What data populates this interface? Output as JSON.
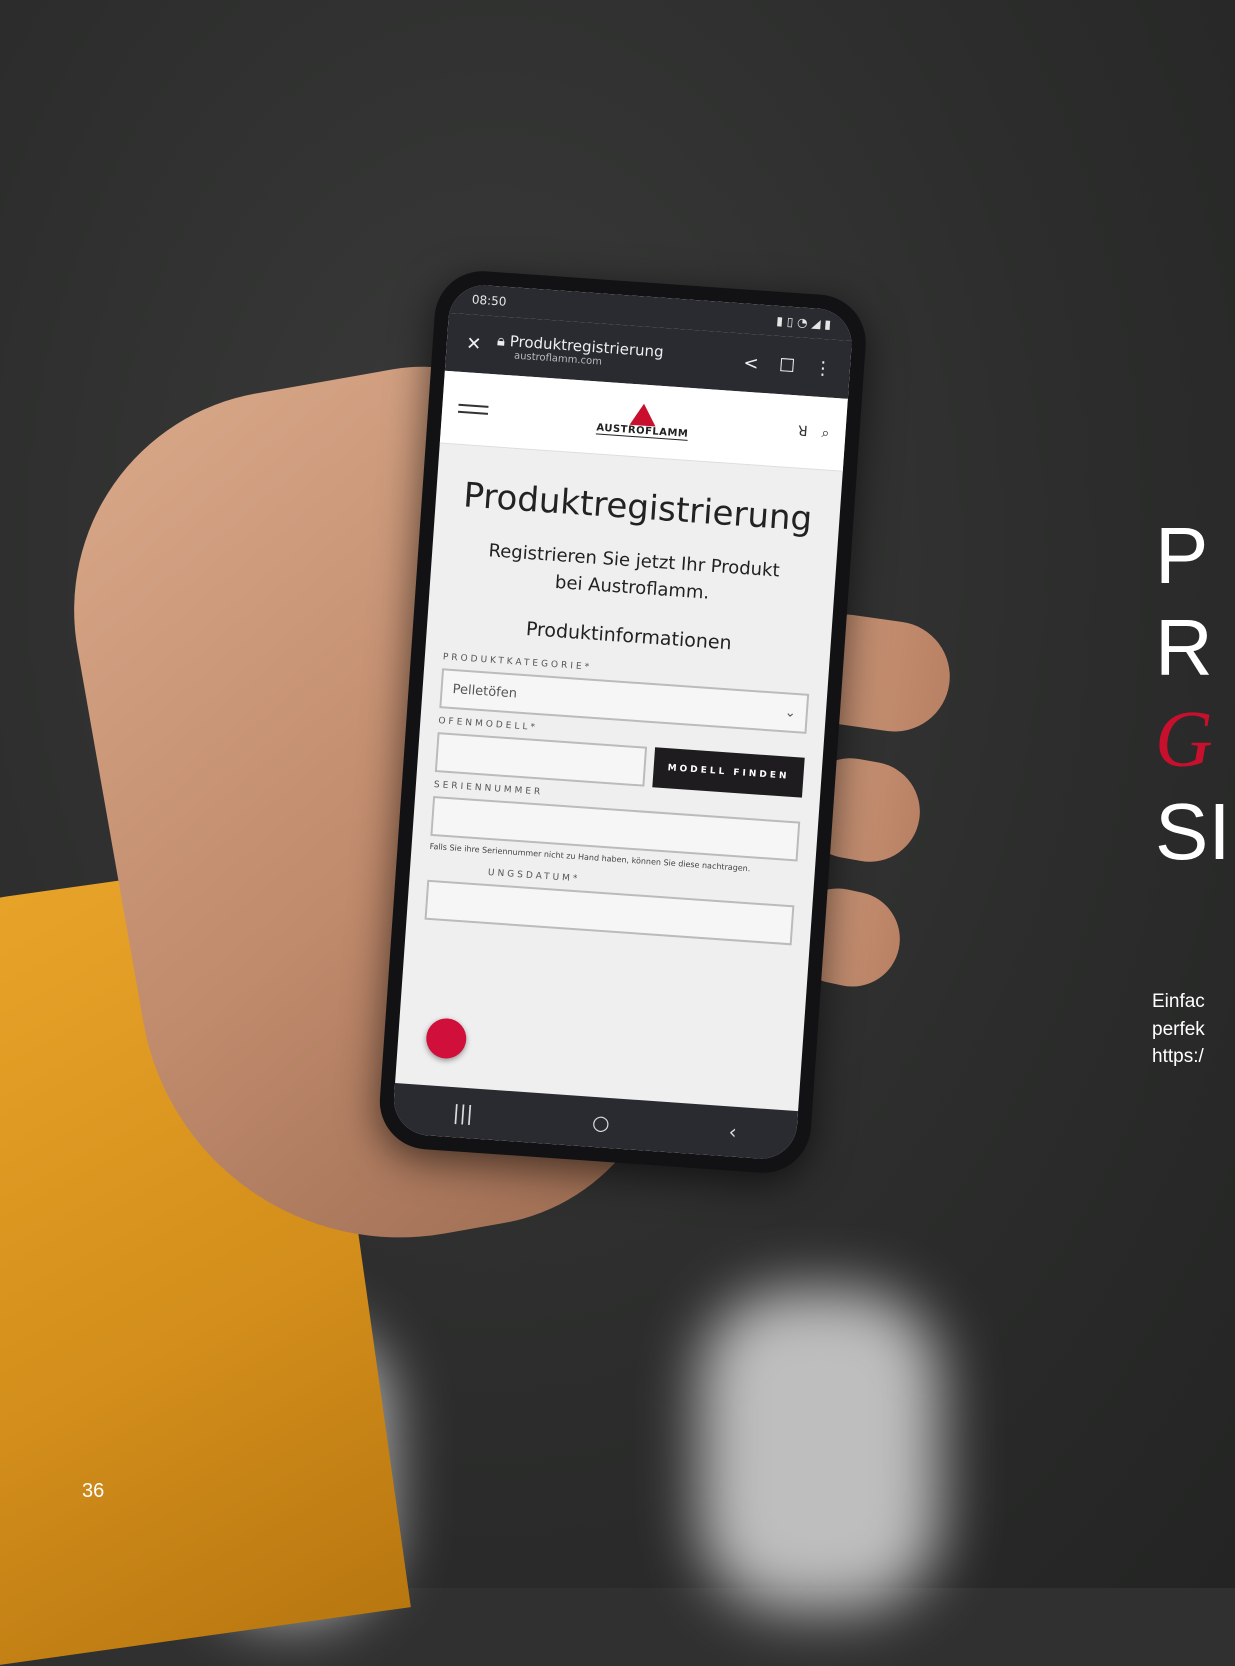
{
  "phone": {
    "status": {
      "time": "08:50"
    },
    "browser": {
      "title": "Produktregistrierung",
      "url": "austroflamm.com"
    },
    "site": {
      "logo": "AUSTROFLAMM"
    },
    "page": {
      "title": "Produktregistrierung",
      "subtitle_line1": "Registrieren Sie jetzt Ihr Produkt",
      "subtitle_line2": "bei Austroflamm.",
      "section": "Produktinformationen",
      "category_label": "PRODUKTKATEGORIE*",
      "category_value": "Pelletöfen",
      "model_label": "OFENMODELL*",
      "model_button": "MODELL FINDEN",
      "serial_label": "SERIENNUMMER",
      "serial_hint": "Falls Sie ihre Seriennummer nicht zu Hand haben, können Sie diese nachtragen.",
      "date_label": "UNGSDATUM*"
    }
  },
  "right": {
    "title_l1": "P",
    "title_l2": "R",
    "title_l3": "G",
    "title_l4": "SI",
    "body_l1": "Einfac",
    "body_l2": "perfek",
    "body_l3": "https:/"
  },
  "page_number": "36"
}
